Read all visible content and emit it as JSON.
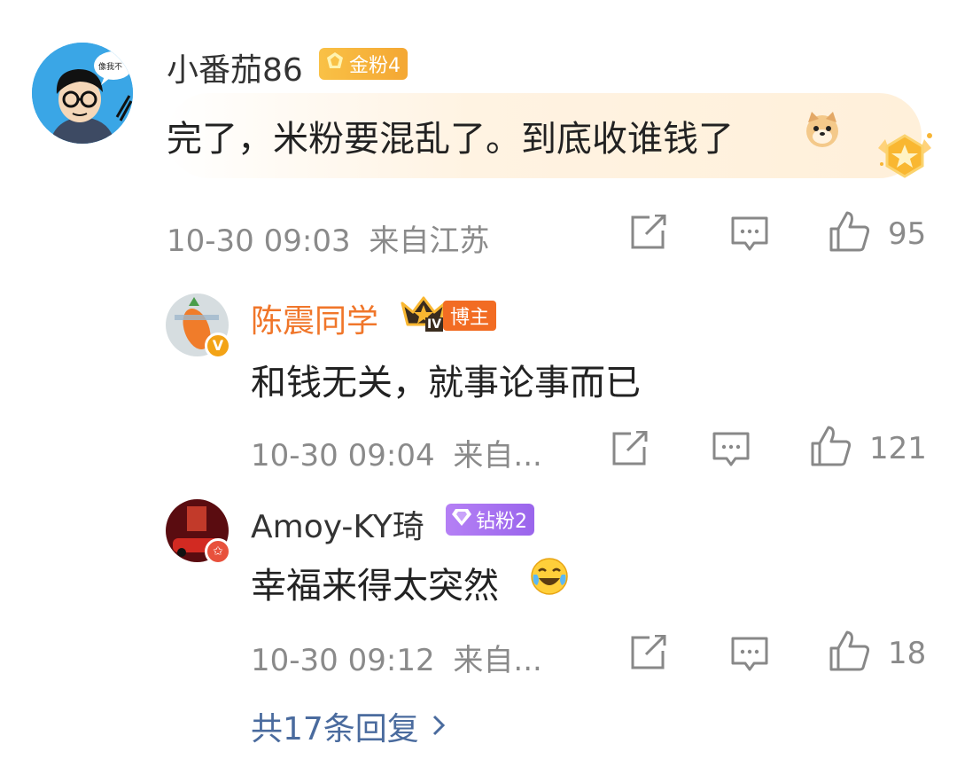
{
  "comment": {
    "username": "小番茄86",
    "badge_label": "金粉4",
    "text": "完了，米粉要混乱了。到底收谁钱了",
    "emoji": "doge-emoji",
    "time": "10-30 09:03",
    "location": "来自江苏",
    "likes": "95",
    "avatar_text": "像我不"
  },
  "replies": [
    {
      "username": "陈震同学",
      "badge_label": "博主",
      "crown_level": "IV",
      "text": "和钱无关，就事论事而已",
      "time": "10-30 09:04",
      "location": "来自...",
      "likes": "121",
      "verified_mark": "V"
    },
    {
      "username": "Amoy-KY琦",
      "badge_label": "钻粉2",
      "text": "幸福来得太突然",
      "emoji": "laugh-cry-emoji",
      "time": "10-30 09:12",
      "location": "来自...",
      "likes": "18"
    }
  ],
  "more_replies": {
    "label": "共17条回复"
  },
  "colors": {
    "username_blogger": "#f0762a",
    "link": "#4a6b9e",
    "gold_badge": "#f4a733",
    "diamond_badge": "#9a65ec",
    "highlight_bg": "#fff0da"
  }
}
